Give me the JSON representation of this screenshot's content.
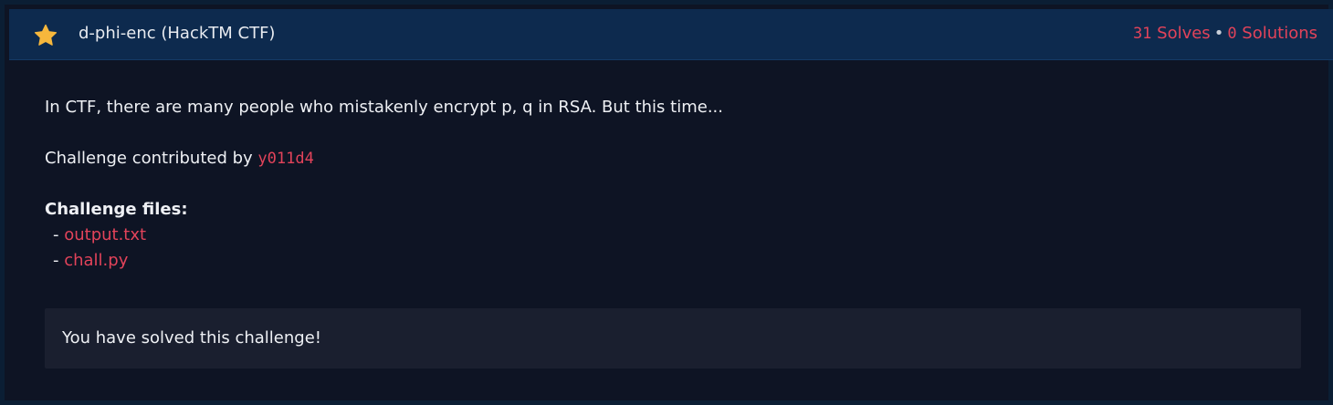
{
  "challenge": {
    "title": "d-phi-enc (HackTM CTF)",
    "star_icon": "star-icon",
    "star_color": "#f6b73c",
    "solves_count": "31",
    "solves_label": " Solves",
    "separator": "•",
    "solutions_count": "0",
    "solutions_label": " Solutions",
    "description": "In CTF, there are many people who mistakenly encrypt p, q in RSA. But this time...",
    "contributed_prefix": "Challenge contributed by ",
    "author": "y011d4",
    "files_heading": "Challenge files:",
    "files": [
      {
        "bullet": "- ",
        "name": "output.txt"
      },
      {
        "bullet": "- ",
        "name": "chall.py"
      }
    ],
    "solved_message": "You have solved this challenge!"
  },
  "colors": {
    "header_bg": "#0d2a4e",
    "page_bg": "#0e1424",
    "accent_red": "#e2435a",
    "solved_box_bg": "#1a1f2f"
  }
}
